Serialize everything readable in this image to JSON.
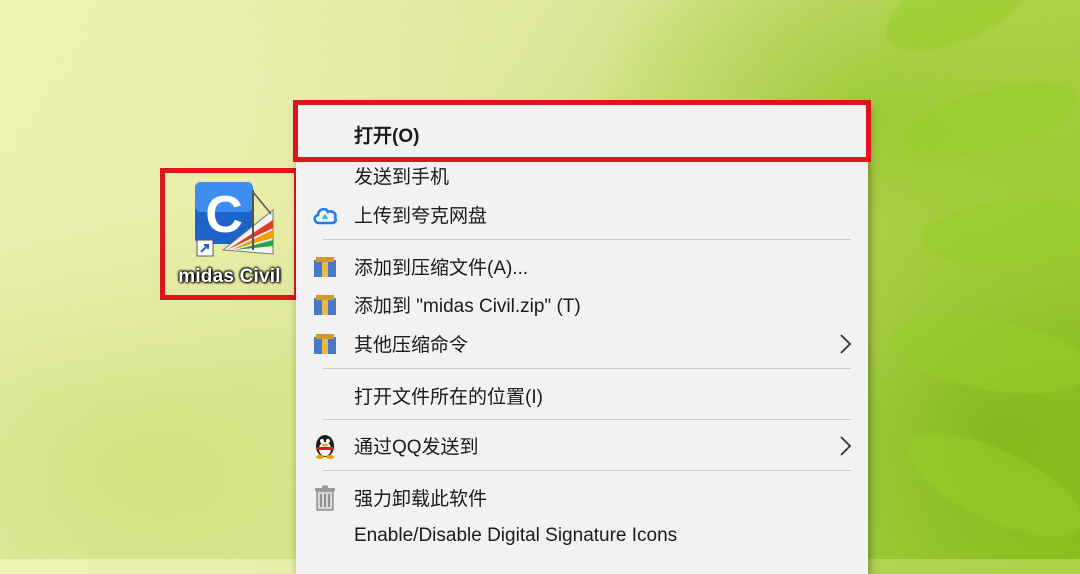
{
  "desktop": {
    "icon_label": "midas Civil",
    "icon_name": "midas-civil-app-icon"
  },
  "context_menu": {
    "items": [
      {
        "label": "打开(O)",
        "icon": "",
        "submenu": false
      },
      {
        "label": "发送到手机",
        "icon": "",
        "submenu": false
      },
      {
        "label": "上传到夸克网盘",
        "icon": "cloud-icon",
        "submenu": false
      },
      {
        "label": "添加到压缩文件(A)...",
        "icon": "archive-icon",
        "submenu": false
      },
      {
        "label": "添加到 \"midas Civil.zip\" (T)",
        "icon": "archive-icon",
        "submenu": false
      },
      {
        "label": "其他压缩命令",
        "icon": "archive-icon",
        "submenu": true
      },
      {
        "label": "打开文件所在的位置(I)",
        "icon": "",
        "submenu": false
      },
      {
        "label": "通过QQ发送到",
        "icon": "qq-penguin-icon",
        "submenu": true
      },
      {
        "label": "强力卸载此软件",
        "icon": "trash-icon",
        "submenu": false
      },
      {
        "label": "Enable/Disable Digital Signature Icons",
        "icon": "",
        "submenu": false
      }
    ]
  },
  "colors": {
    "highlight": "#e0141e",
    "menu_bg": "#f2f2f2",
    "cloud_blue": "#1a7df0"
  }
}
